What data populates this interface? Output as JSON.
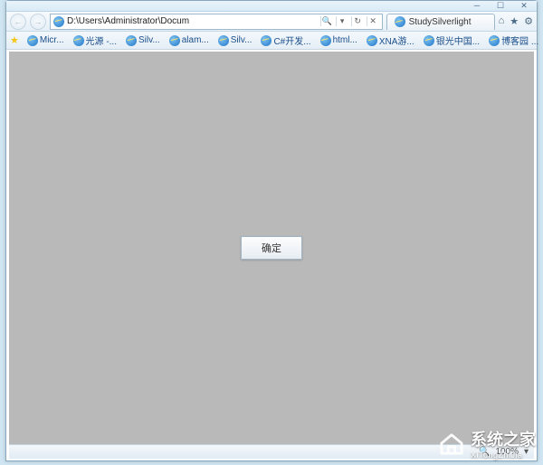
{
  "window": {
    "minimize": "─",
    "maximize": "☐",
    "close": "✕"
  },
  "nav": {
    "back": "←",
    "forward": "→",
    "address": "D:\\Users\\Administrator\\Docum",
    "search_glyph": "🔍",
    "dropdown_glyph": "▾",
    "refresh_glyph": "↻",
    "stop_glyph": "✕"
  },
  "tab": {
    "title": "StudySilverlight"
  },
  "top_icons": {
    "home": "⌂",
    "favorites": "★",
    "tools": "⚙"
  },
  "bookmarks": [
    {
      "label": "Micr..."
    },
    {
      "label": "光源 -..."
    },
    {
      "label": "Silv..."
    },
    {
      "label": "alam..."
    },
    {
      "label": "Silv..."
    },
    {
      "label": "C#开发..."
    },
    {
      "label": "html..."
    },
    {
      "label": "XNA游..."
    },
    {
      "label": "银光中国..."
    },
    {
      "label": "博客园 ..."
    }
  ],
  "bookmark_more": "»",
  "dialog": {
    "ok": "确定"
  },
  "status": {
    "zoom_glyph": "🔍",
    "zoom": "100%",
    "zoom_drop": "▾"
  },
  "watermark": {
    "title": "系统之家",
    "sub": "XiTongZhiJia"
  }
}
